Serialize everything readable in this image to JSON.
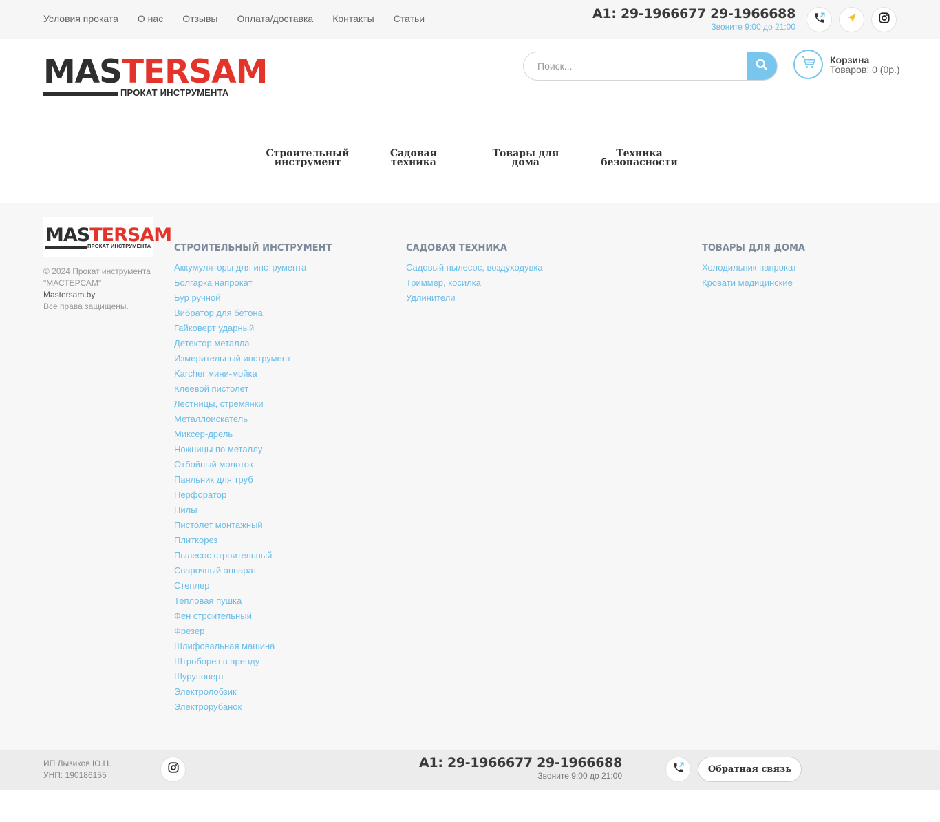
{
  "topnav": [
    {
      "label": "Условия проката"
    },
    {
      "label": "О нас"
    },
    {
      "label": "Отзывы"
    },
    {
      "label": "Оплата/доставка"
    },
    {
      "label": "Контакты"
    },
    {
      "label": "Статьи"
    }
  ],
  "contact": {
    "phones": "А1: 29-1966677 29-1966688",
    "hours": "Звоните 9:00 до 21:00"
  },
  "icons": {
    "phone": "phone-icon",
    "location": "location-icon",
    "instagram": "instagram-icon",
    "search": "search-icon",
    "cart": "cart-icon"
  },
  "logo": {
    "part1": "MAS",
    "part2": "TER",
    "part3": "SAM",
    "tagline": "ПРОКАТ ИНСТРУМЕНТА"
  },
  "search": {
    "placeholder": "Поиск..."
  },
  "cart": {
    "title": "Корзина",
    "count": "Товаров: 0 (0р.)"
  },
  "categories": [
    {
      "line1": "Строительный",
      "line2": "инструмент"
    },
    {
      "line1": "Садовая",
      "line2": "техника"
    },
    {
      "line1": "Товары для",
      "line2": "дома"
    },
    {
      "line1": "Техника",
      "line2": "безопасности"
    }
  ],
  "footer": {
    "copyright_line1": "© 2024 Прокат инструмента",
    "copyright_line2": "\"МАСТЕРСАМ\"",
    "site": "Mastersam.by",
    "rights": "Все права защищены.",
    "columns": [
      {
        "title": "Строительный инструмент",
        "items": [
          "Аккумуляторы для инструмента",
          "Болгарка напрокат",
          "Бур ручной",
          "Вибратор для бетона",
          "Гайковерт ударный",
          "Детектор металла",
          "Измерительный инструмент",
          "Karcher мини-мойка",
          "Клеевой пистолет",
          "Лестницы, стремянки",
          "Металлоискатель",
          "Миксер-дрель",
          "Ножницы по металлу",
          "Отбойный молоток",
          "Паяльник для труб",
          "Перфоратор",
          "Пилы",
          "Пистолет монтажный",
          "Плиткорез",
          "Пылесос строительный",
          "Сварочный аппарат",
          "Степлер",
          "Тепловая пушка",
          "Фен строительный",
          "Фрезер",
          "Шлифовальная машина",
          "Штроборез в аренду",
          "Шуруповерт",
          "Электролобзик",
          "Электрорубанок"
        ]
      },
      {
        "title": "Садовая техника",
        "items": [
          "Садовый пылесос, воздуходувка",
          "Триммер, косилка",
          "Удлинители"
        ]
      },
      {
        "title": "Товары для дома",
        "items": [
          "Холодильник напрокат",
          "Кровати медицинские"
        ]
      }
    ]
  },
  "bottom": {
    "company": "ИП Лызиков Ю.Н.",
    "unp": "УНП: 190186155",
    "phones": "А1: 29-1966677 29-1966688",
    "hours": "Звоните 9:00 до 21:00",
    "callback": "Обратная связь"
  },
  "colors": {
    "accent": "#78c6ee",
    "link": "#6bbde8",
    "brand_red": "#e2342a"
  }
}
